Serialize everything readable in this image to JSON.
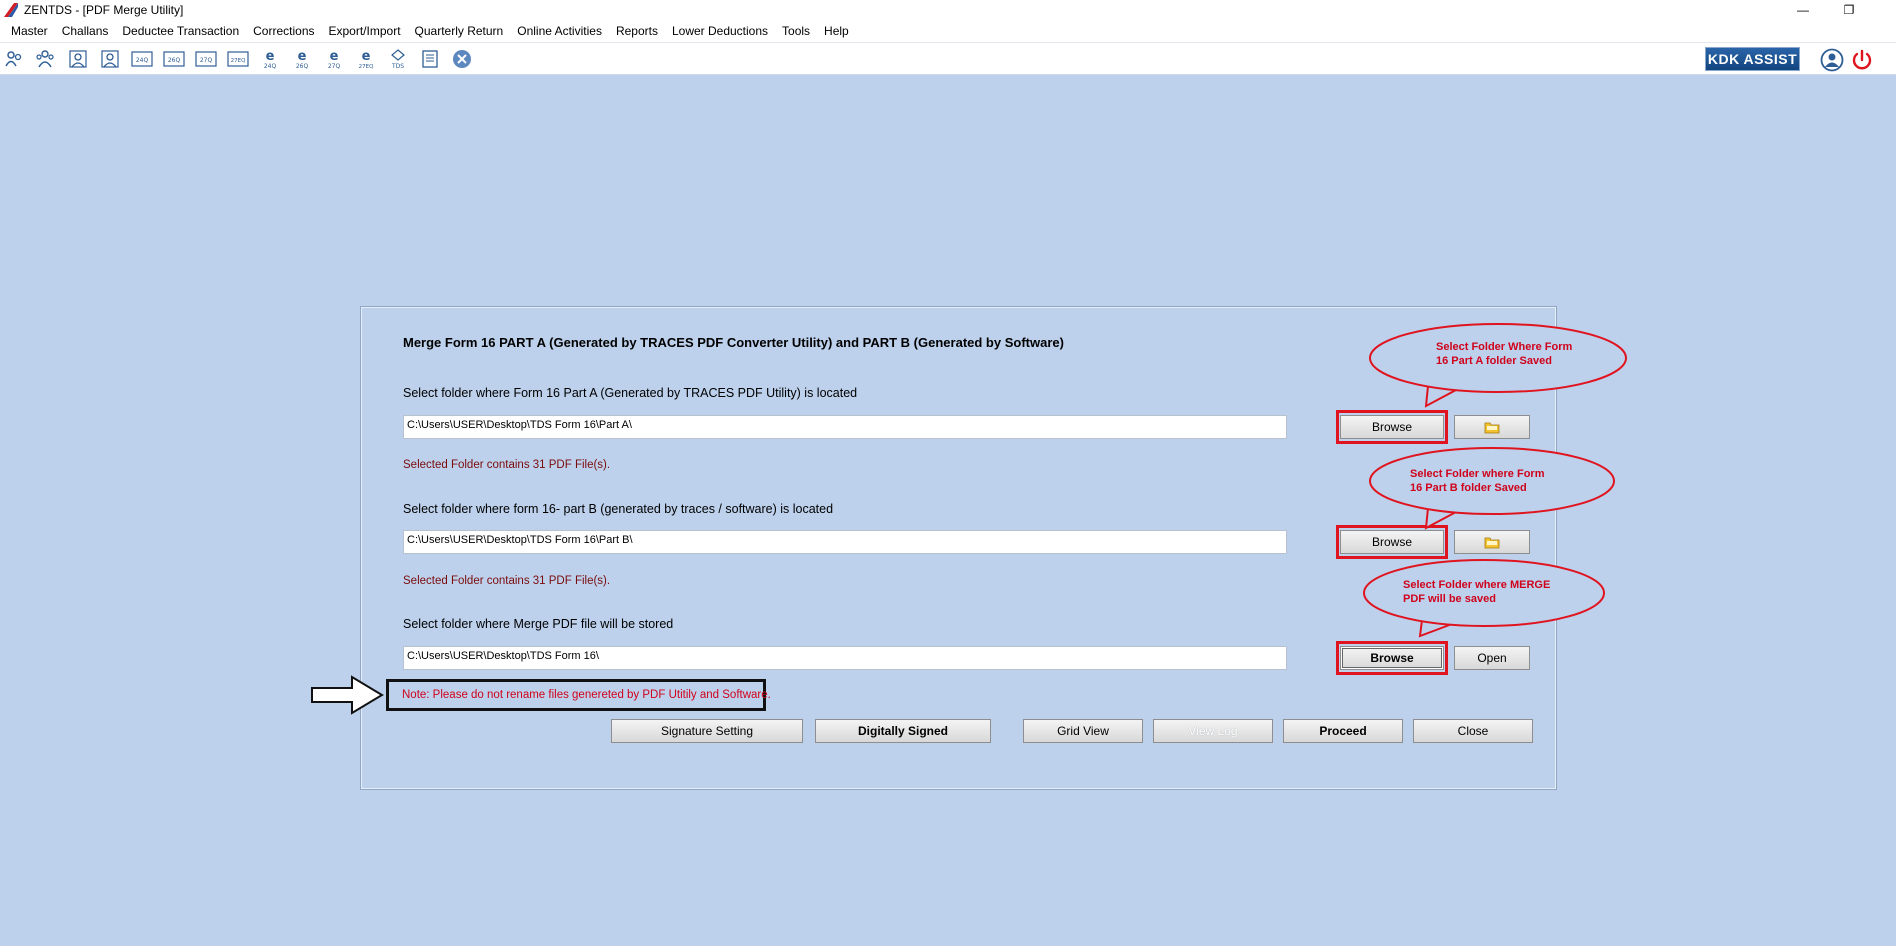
{
  "window": {
    "title": "ZENTDS - [PDF Merge Utility]",
    "minimize_glyph": "—",
    "restore_glyph": "❐"
  },
  "menu": [
    "Master",
    "Challans",
    "Deductee Transaction",
    "Corrections",
    "Export/Import",
    "Quarterly Return",
    "Online Activities",
    "Reports",
    "Lower Deductions",
    "Tools",
    "Help"
  ],
  "toolbar": {
    "icons": [
      {
        "name": "deductor-icon",
        "label": ""
      },
      {
        "name": "deductees-icon",
        "label": ""
      },
      {
        "name": "employee-icon",
        "label": ""
      },
      {
        "name": "employee-2-icon",
        "label": ""
      },
      {
        "name": "form-24q-icon",
        "label": "24Q"
      },
      {
        "name": "form-26q-icon",
        "label": "26Q"
      },
      {
        "name": "form-27q-icon",
        "label": "27Q"
      },
      {
        "name": "form-27eq-icon",
        "label": "27EQ"
      },
      {
        "name": "e-24q-icon",
        "label": "24Q"
      },
      {
        "name": "e-26q-icon",
        "label": "26Q"
      },
      {
        "name": "e-27q-icon",
        "label": "27Q"
      },
      {
        "name": "e-27eq-icon",
        "label": "27EQ"
      },
      {
        "name": "tds-icon",
        "label": "TDS"
      },
      {
        "name": "report-icon",
        "label": ""
      },
      {
        "name": "close-circle-icon",
        "label": ""
      }
    ],
    "kdk_assist": "KDK ASSIST"
  },
  "dialog": {
    "title": "Merge Form 16 PART A (Generated by TRACES PDF Converter Utility) and PART B (Generated by Software)",
    "part_a": {
      "label": "Select folder where Form 16 Part A (Generated by TRACES PDF Utility) is located",
      "path": "C:\\Users\\USER\\Desktop\\TDS Form 16\\Part A\\",
      "info": "Selected Folder contains 31 PDF File(s).",
      "browse": "Browse"
    },
    "part_b": {
      "label": "Select folder where form 16- part B (generated by traces / software) is located",
      "path": "C:\\Users\\USER\\Desktop\\TDS Form 16\\Part B\\",
      "info": "Selected Folder contains 31 PDF File(s).",
      "browse": "Browse"
    },
    "merge": {
      "label": "Select folder where Merge PDF file will be stored",
      "path": "C:\\Users\\USER\\Desktop\\TDS Form 16\\",
      "browse": "Browse",
      "open": "Open"
    },
    "note": "Note: Please do not rename files genereted by PDF Utitily and Software.",
    "buttons": {
      "signature_setting": "Signature Setting",
      "digitally_signed": "Digitally Signed",
      "grid_view": "Grid View",
      "view_log": "View Log",
      "proceed": "Proceed",
      "close": "Close"
    }
  },
  "callouts": {
    "part_a": [
      "Select Folder Where Form",
      "16 Part A folder Saved"
    ],
    "part_b": [
      "Select Folder where Form",
      "16 Part B folder Saved"
    ],
    "merge": [
      "Select Folder where MERGE",
      "PDF will be saved"
    ]
  },
  "colors": {
    "background": "#bdd1ec",
    "annotation_red": "#e0141e",
    "info_text": "#7a0c0c",
    "kdk_blue": "#1a4f8f"
  }
}
